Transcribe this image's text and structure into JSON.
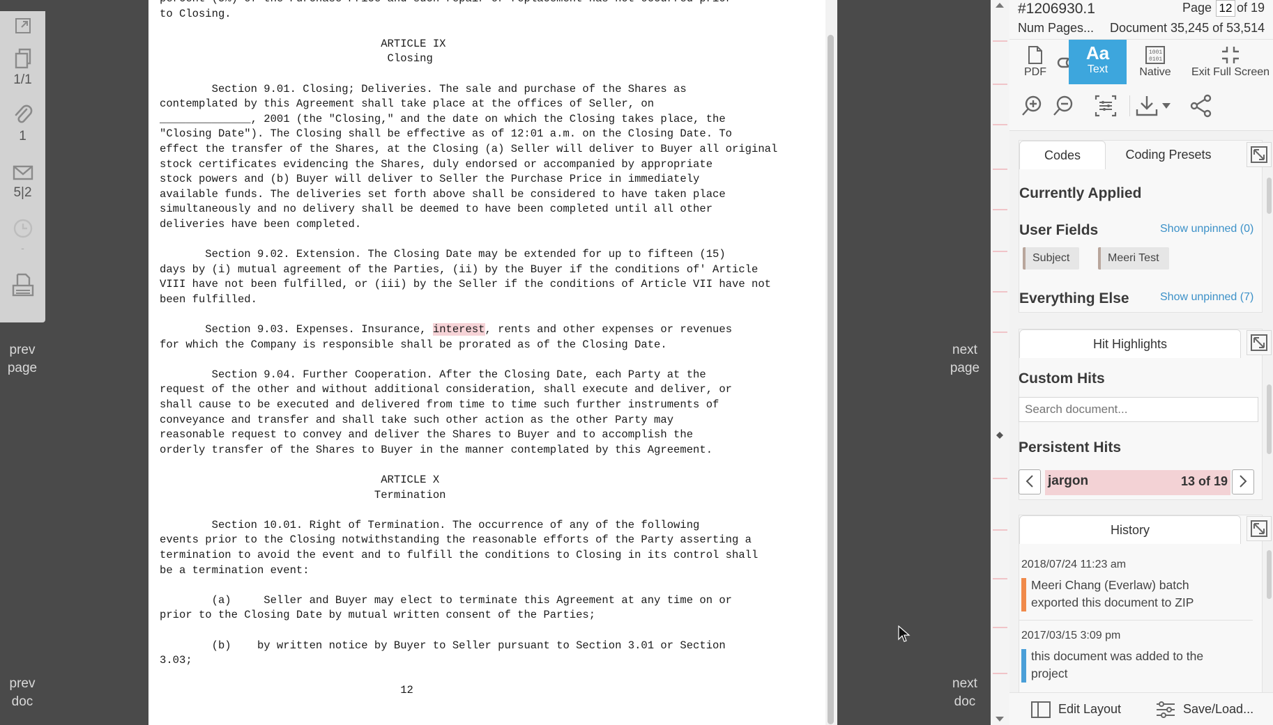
{
  "left_toolbar": {
    "items": [
      {
        "icon": "expand-window-icon",
        "count": ""
      },
      {
        "icon": "copies-icon",
        "count": "1/1"
      },
      {
        "icon": "paperclip-icon",
        "count": "1"
      },
      {
        "icon": "envelope-icon",
        "count": "5|2"
      },
      {
        "icon": "clock-icon",
        "count": "-"
      },
      {
        "icon": "printer-icon",
        "count": ""
      }
    ]
  },
  "nav": {
    "prev_page": [
      "prev",
      "page"
    ],
    "next_page": [
      "next",
      "page"
    ],
    "prev_doc": [
      "prev",
      "doc"
    ],
    "next_doc": [
      "next",
      "doc"
    ]
  },
  "document": {
    "lines_before_highlight": [
      "percent (5%) of the Purchase Price and such repair or replacement has not occurred prior",
      "to Closing.",
      "",
      "                                  ARTICLE IX",
      "                                   Closing",
      "",
      "        Section 9.01. Closing; Deliveries. The sale and purchase of the Shares as",
      "contemplated by this Agreement shall take place at the offices of Seller, on",
      "______________, 2001 (the \"Closing,\" and the date on which the Closing takes place, the",
      "\"Closing Date\"). The Closing shall be effective as of 12:01 a.m. on the Closing Date. To",
      "effect the transfer of the Shares, at the Closing (a) Seller will deliver to Buyer all original",
      "stock certificates evidencing the Shares, duly endorsed or accompanied by appropriate",
      "stock powers and (b) Buyer will deliver to Seller the Purchase Price in immediately",
      "available funds. The deliveries set forth above shall be considered to have taken place",
      "simultaneously and no delivery shall be deemed to have been completed until all other",
      "deliveries have been completed.",
      "",
      "       Section 9.02. Extension. The Closing Date may be extended for up to fifteen (15)",
      "days by (i) mutual agreement of the Parties, (ii) by the Buyer if the conditions of' Article",
      "VIII have not been fulfilled, or (iii) by the Seller if the conditions of Article VII have not",
      "been fulfilled.",
      ""
    ],
    "highlight_line_prefix": "       Section 9.03. Expenses. Insurance, ",
    "highlight_word": "interest",
    "highlight_line_suffix": ", rents and other expenses or revenues",
    "lines_after_highlight": [
      "for which the Company is responsible shall be prorated as of the Closing Date.",
      "",
      "        Section 9.04. Further Cooperation. After the Closing Date, each Party at the",
      "request of the other and without additional consideration, shall execute and deliver, or",
      "shall cause to be executed and delivered from time to time such further instruments of",
      "conveyance and transfer and shall take such other action as the other Party may",
      "reasonable request to convey and deliver the Shares to Buyer and to accomplish the",
      "orderly transfer of the Shares to Buyer in the manner contemplated by this Agreement.",
      "",
      "                                  ARTICLE X",
      "                                 Termination",
      "",
      "        Section 10.01. Right of Termination. The occurrence of any of the following",
      "events prior to the Closing notwithstanding the reasonable efforts of the Party asserting a",
      "termination to avoid the event and to fulfill the conditions to Closing in its control shall",
      "be a termination event:",
      "",
      "        (a)     Seller and Buyer may elect to terminate this Agreement at any time on or",
      "prior to the Closing Date by mutual written consent of the Parties;",
      "",
      "        (b)    by written notice by Buyer to Seller pursuant to Section 3.01 or Section",
      "3.03;",
      "",
      "                                     12"
    ]
  },
  "header": {
    "doc_id": "#1206930.1",
    "page_label": "Page",
    "page_current": "12",
    "page_total": "of 19",
    "num_pages": "Num Pages...",
    "doc_position": "Document 35,245 of 53,514"
  },
  "view_modes": [
    {
      "label": "PDF",
      "icon": "file-icon",
      "active": false
    },
    {
      "label": "Text",
      "icon": "text-aa-icon",
      "active": true
    },
    {
      "label": "Native",
      "icon": "binary-file-icon",
      "active": false
    },
    {
      "label": "Exit Full Screen",
      "icon": "exit-fullscreen-icon",
      "active": false
    }
  ],
  "codes_card": {
    "tabs": [
      "Codes",
      "Coding Presets"
    ],
    "currently_applied": "Currently Applied",
    "user_fields": "User Fields",
    "user_fields_link": "Show unpinned (0)",
    "chips": [
      "Subject",
      "Meeri Test"
    ],
    "everything_else": "Everything Else",
    "everything_else_link": "Show unpinned (7)"
  },
  "hits_card": {
    "tab": "Hit Highlights",
    "custom_hits": "Custom Hits",
    "search_placeholder": "Search document...",
    "persistent_hits": "Persistent Hits",
    "hit_term": "jargon",
    "hit_count": "13 of 19"
  },
  "history_card": {
    "tab": "History",
    "entries": [
      {
        "date": "2018/07/24 11:23 am",
        "lines": [
          "Meeri Chang (Everlaw) batch",
          "exported this document to ZIP"
        ],
        "color": "#f08a4b"
      },
      {
        "date": "2017/03/15 3:09 pm",
        "lines": [
          "this document was added to the",
          "project"
        ],
        "color": "#4a9fd8"
      }
    ]
  },
  "bottom_bar": {
    "edit_layout": "Edit Layout",
    "save_load": "Save/Load..."
  },
  "colors": {
    "accent": "#3da6dd",
    "hit_highlight": "#f3d2d5",
    "link": "#3c91c8"
  }
}
